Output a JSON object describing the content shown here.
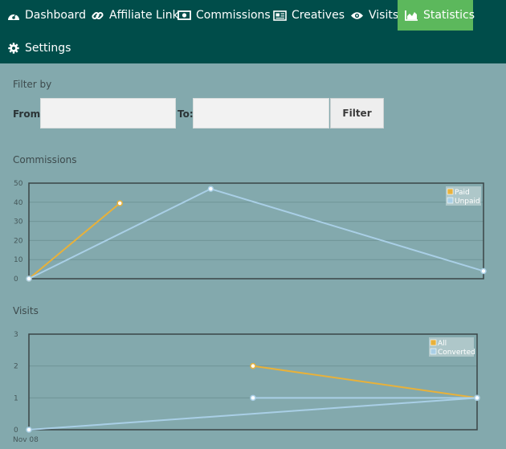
{
  "nav": {
    "items": [
      {
        "label": "Dashboard",
        "icon": "dashboard-icon",
        "active": false
      },
      {
        "label": "Affiliate Link",
        "icon": "link-icon",
        "active": false
      },
      {
        "label": "Commissions",
        "icon": "money-icon",
        "active": false
      },
      {
        "label": "Creatives",
        "icon": "newspaper-icon",
        "active": false
      },
      {
        "label": "Visits",
        "icon": "eye-icon",
        "active": false
      },
      {
        "label": "Statistics",
        "icon": "area-chart-icon",
        "active": true
      },
      {
        "label": "Settings",
        "icon": "gear-icon",
        "active": false
      }
    ]
  },
  "filter": {
    "title": "Filter by",
    "from_label": "From:",
    "to_label": "To:",
    "from_value": "",
    "to_value": "",
    "button_label": "Filter"
  },
  "commissions": {
    "title": "Commissions"
  },
  "visits": {
    "title": "Visits"
  },
  "colors": {
    "nav_bg": "#004d4a",
    "active_tab": "#5cb85c",
    "page_bg": "#83a9ad",
    "series_orange": "#e8b13a",
    "series_blue": "#a9cfe6"
  },
  "chart_data": [
    {
      "type": "line",
      "title": "Commissions",
      "ylim": [
        0,
        50
      ],
      "yticks": [
        0,
        10,
        20,
        30,
        40,
        50
      ],
      "xlim": [
        0,
        100
      ],
      "xtick_labels": [],
      "legend_position": "top-right",
      "grid": true,
      "series": [
        {
          "name": "Paid",
          "color": "#e8b13a",
          "points": [
            [
              0,
              0
            ],
            [
              20,
              39.5
            ]
          ]
        },
        {
          "name": "Unpaid",
          "color": "#a9cfe6",
          "points": [
            [
              0,
              0
            ],
            [
              40,
              47
            ],
            [
              100,
              4
            ]
          ]
        }
      ]
    },
    {
      "type": "line",
      "title": "Visits",
      "ylim": [
        0,
        3
      ],
      "yticks": [
        0,
        1,
        2,
        3
      ],
      "xlim": [
        0,
        100
      ],
      "xtick_labels": [
        "Nov 08"
      ],
      "legend_position": "top-right",
      "grid": true,
      "series": [
        {
          "name": "All",
          "color": "#e8b13a",
          "points": [
            [
              50,
              2
            ],
            [
              100,
              1
            ]
          ]
        },
        {
          "name": "Converted",
          "color": "#a9cfe6",
          "points": [
            [
              0,
              0
            ],
            [
              100,
              1
            ]
          ]
        },
        {
          "name": "",
          "color": "#a9cfe6",
          "points": [
            [
              50,
              1
            ],
            [
              100,
              1
            ]
          ]
        }
      ]
    }
  ]
}
